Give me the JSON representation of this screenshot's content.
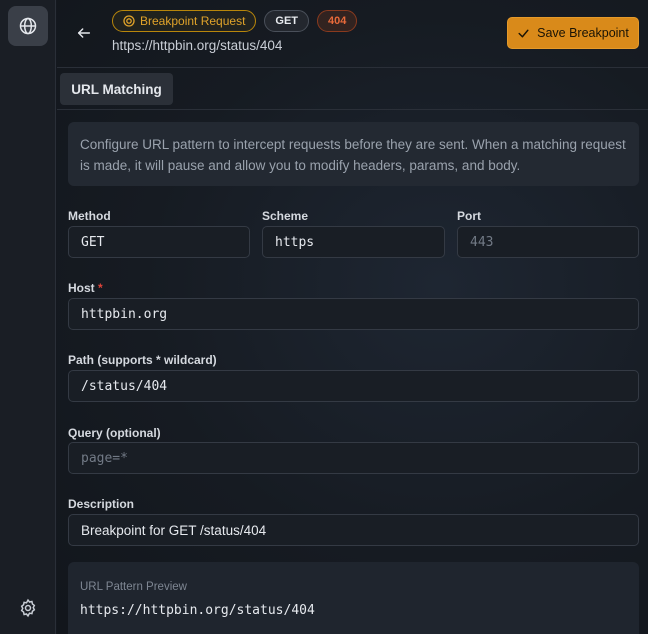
{
  "header": {
    "badge_breakpoint": "Breakpoint Request",
    "badge_method": "GET",
    "badge_status": "404",
    "url": "https://httpbin.org/status/404",
    "save_label": "Save Breakpoint"
  },
  "tabs": [
    {
      "label": "URL Matching"
    }
  ],
  "info_text": "Configure URL pattern to intercept requests before they are sent. When a matching request is made, it will pause and allow you to modify headers, params, and body.",
  "form": {
    "method": {
      "label": "Method",
      "value": "GET"
    },
    "scheme": {
      "label": "Scheme",
      "value": "https"
    },
    "port": {
      "label": "Port",
      "placeholder": "443"
    },
    "host": {
      "label": "Host",
      "required_mark": "*",
      "value": "httpbin.org"
    },
    "path": {
      "label": "Path (supports * wildcard)",
      "value": "/status/404"
    },
    "query": {
      "label": "Query (optional)",
      "placeholder": "page=*"
    },
    "description": {
      "label": "Description",
      "value": "Breakpoint for GET /status/404"
    }
  },
  "preview": {
    "label": "URL Pattern Preview",
    "value": "https://httpbin.org/status/404"
  },
  "colors": {
    "accent": "#d98a1a",
    "status_404": "#e86a3a",
    "required": "#e0443a"
  },
  "icons": [
    "globe-icon",
    "settings-icon",
    "back-arrow-icon",
    "breakpoint-icon",
    "check-icon"
  ]
}
